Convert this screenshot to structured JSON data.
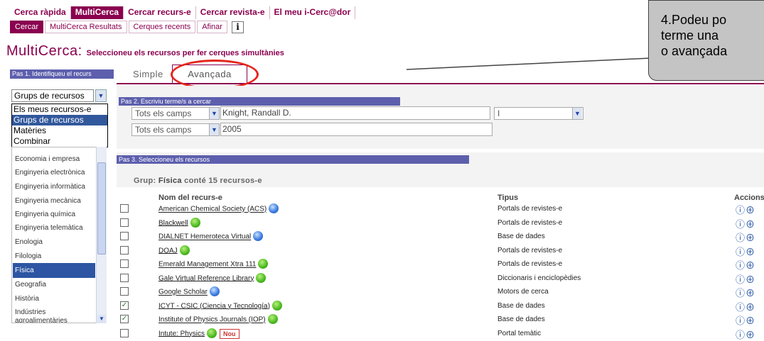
{
  "top_tabs": [
    "Cerca ràpida",
    "MultiCerca",
    "Cercar recurs-e",
    "Cercar revista-e",
    "El meu i-Cerc@dor"
  ],
  "sub_tabs": [
    "Cercar",
    "MultiCerca Resultats",
    "Cerques recents",
    "Afinar"
  ],
  "info_glyph": "i",
  "title": {
    "main": "MultiCerca:",
    "sub": "Seleccioneu els recursos per fer cerques simultànies"
  },
  "step1": "Pas 1. Identifiqueu el recurs",
  "resource_select": {
    "value": "Grups de recursos",
    "arrow": "▼"
  },
  "dropdown_options": [
    "Els meus recursos-e",
    "Grups de recursos",
    "Matèries",
    "Combinar"
  ],
  "subjects": [
    "Economia i empresa",
    "Enginyeria electrònica",
    "Enginyeria informàtica",
    "Enginyeria mecànica",
    "Enginyeria química",
    "Enginyeria telemàtica",
    "Enologia",
    "Filologia",
    "Física",
    "Geografia",
    "Història",
    "Indústries",
    "agroalimentàries"
  ],
  "search_tabs": {
    "simple": "Simple",
    "advanced": "Avançada"
  },
  "step2": "Pas 2.   Escriviu terme/s a cercar",
  "fields": [
    {
      "field": "Tots els camps",
      "value": "Knight, Randall D.",
      "operator": "I"
    },
    {
      "field": "Tots els camps",
      "value": "2005"
    }
  ],
  "step3": "Pas 3. Seleccioneu els recursos",
  "group": {
    "prefix": "Grup:",
    "name": "Física",
    "suffix": "conté 15 recursos-e"
  },
  "headers": {
    "name": "Nom del recurs-e",
    "type": "Tipus",
    "actions": "Accions"
  },
  "rows": [
    {
      "name": "American Chemical Society (ACS)",
      "dot": "blue",
      "type": "Portals de revistes-e",
      "checked": false
    },
    {
      "name": "Blackwell",
      "dot": "green",
      "type": "Portals de revistes-e",
      "checked": false
    },
    {
      "name": "DIALNET Hemeroteca Virtual",
      "dot": "blue",
      "type": "Base de dades",
      "checked": false
    },
    {
      "name": "DOAJ",
      "dot": "green",
      "type": "Portals de revistes-e",
      "checked": false
    },
    {
      "name": "Emerald Management Xtra 111",
      "dot": "green",
      "type": "Portals de revistes-e",
      "checked": false
    },
    {
      "name": "Gale Virtual Reference Library",
      "dot": "green",
      "type": "Diccionaris i enciclopèdies",
      "checked": false
    },
    {
      "name": "Google Scholar",
      "dot": "blue",
      "type": "Motors de cerca",
      "checked": false
    },
    {
      "name": "ICYT - CSIC (Ciencia y Tecnología)",
      "dot": "green",
      "type": "Base de dades",
      "checked": true
    },
    {
      "name": "Institute of Physics Journals (IOP)",
      "dot": "green",
      "type": "Base de dades",
      "checked": true
    },
    {
      "name": "Intute: Physics",
      "dot": "green",
      "type": "Portal temàtic",
      "checked": false,
      "badge": "Nou"
    }
  ],
  "action_glyphs": "ⓘ⊕",
  "check_glyph": "✓",
  "callout": "4.Podeu po\nterme una \no avançada",
  "colors": {
    "brand": "#8a004f",
    "step_bar": "#5d5fad",
    "highlight": "#e5261d"
  }
}
